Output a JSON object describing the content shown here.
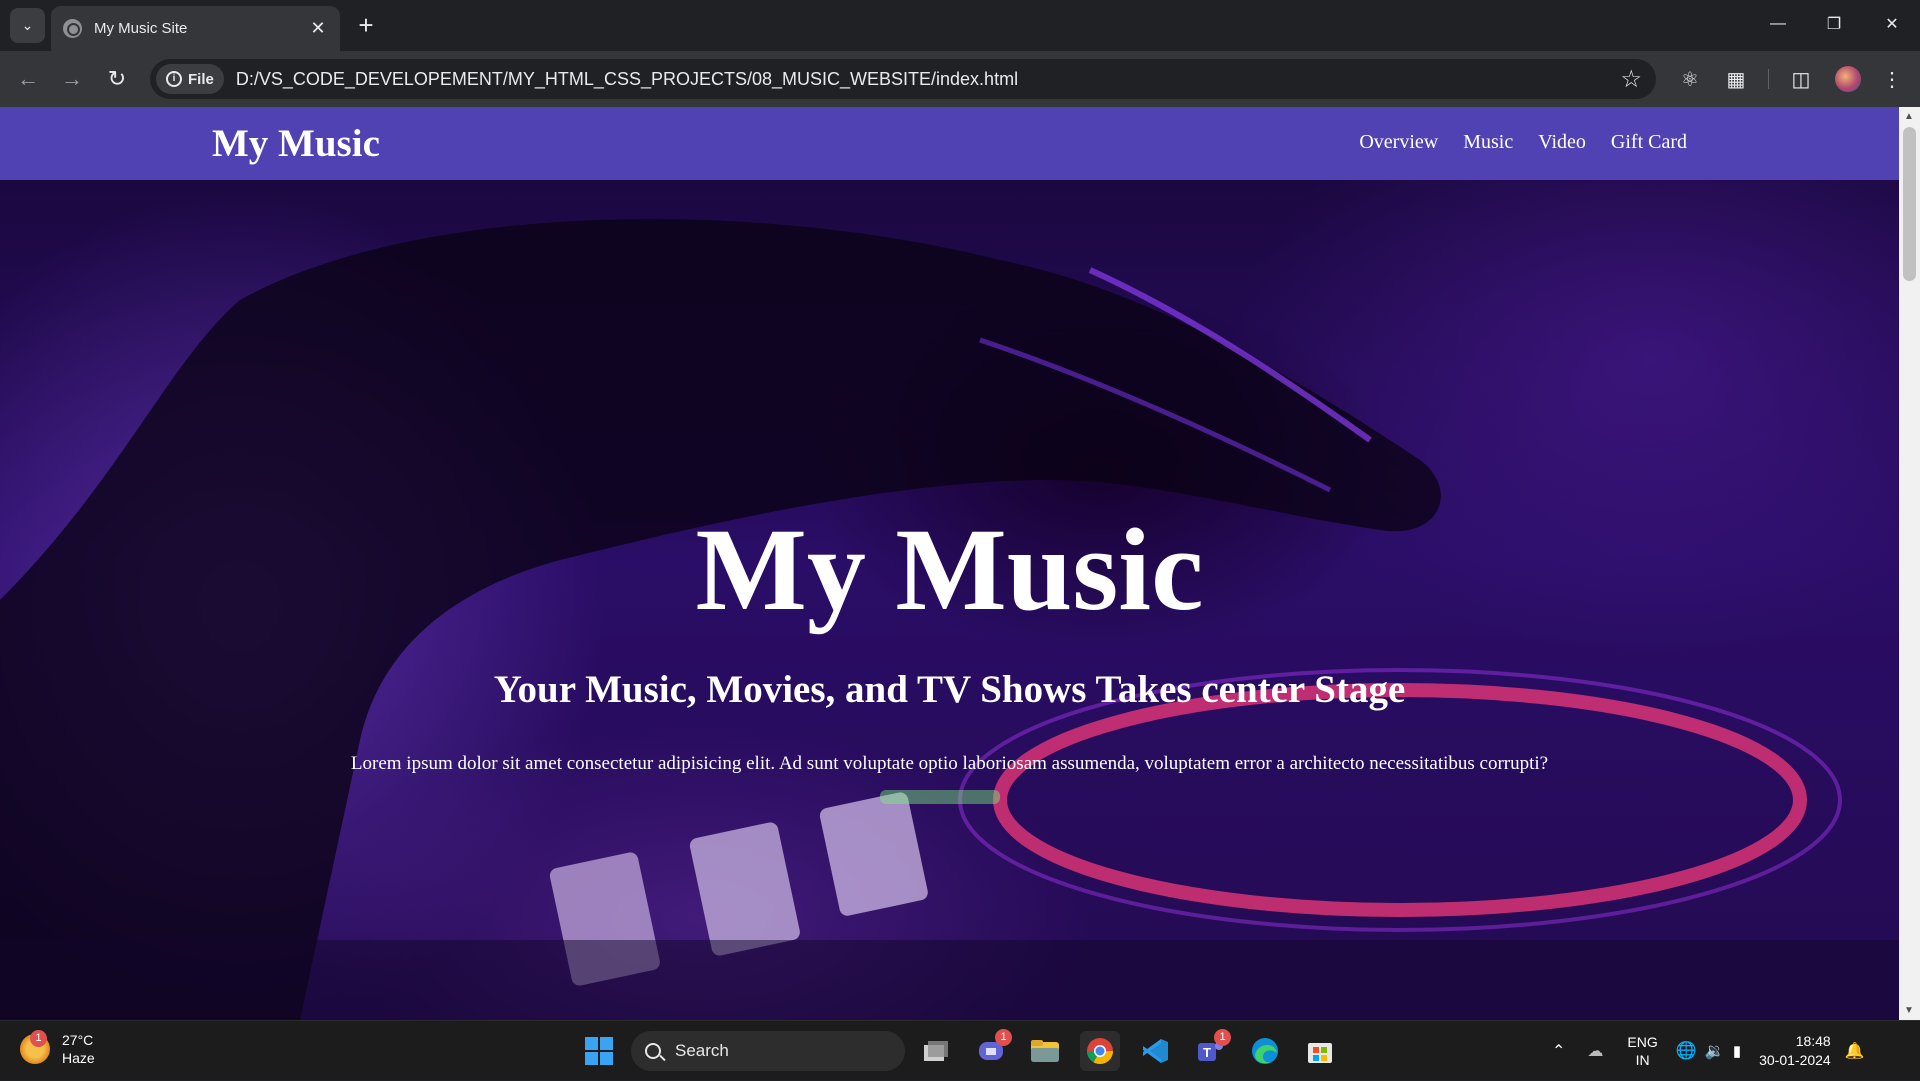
{
  "browser": {
    "tab_title": "My Music Site",
    "new_tab_label": "+",
    "url_chip": "File",
    "url": "D:/VS_CODE_DEVELOPEMENT/MY_HTML_CSS_PROJECTS/08_MUSIC_WEBSITE/index.html"
  },
  "site": {
    "brand": "My Music",
    "nav": [
      "Overview",
      "Music",
      "Video",
      "Gift Card"
    ],
    "hero_title": "My Music",
    "hero_subtitle": "Your Music, Movies, and TV Shows Takes center Stage",
    "hero_text": "Lorem ipsum dolor sit amet consectetur adipisicing elit. Ad sunt voluptate optio laboriosam assumenda, voluptatem error a architecto necessitatibus corrupti?",
    "colors": {
      "nav_bg": "#5142b4",
      "text": "#ffffff"
    }
  },
  "taskbar": {
    "weather_temp": "27°C",
    "weather_desc": "Haze",
    "weather_badge": "1",
    "search_label": "Search",
    "teams_badge": "1",
    "teams2_badge": "1",
    "lang_line1": "ENG",
    "lang_line2": "IN",
    "time": "18:48",
    "date": "30-01-2024"
  }
}
